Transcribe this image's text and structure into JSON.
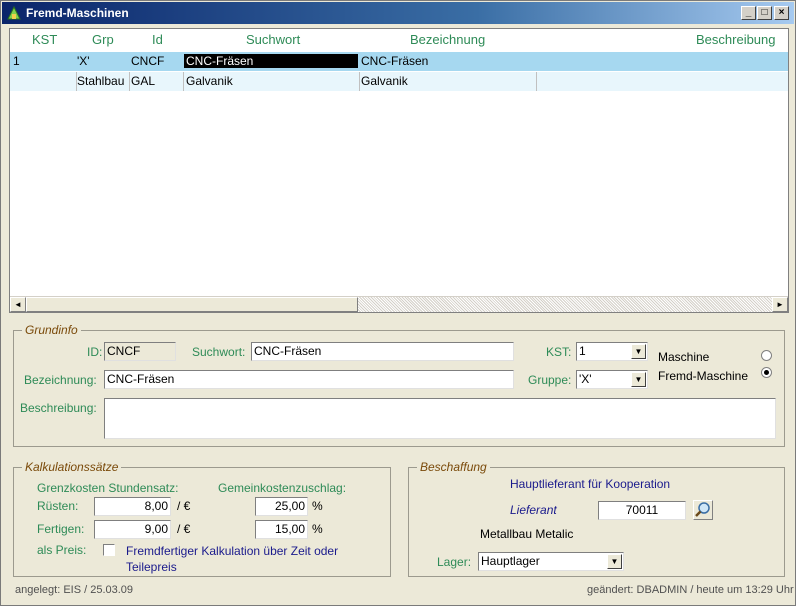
{
  "window": {
    "title": "Fremd-Maschinen",
    "minimize": "_",
    "maximize": "□",
    "close": "×"
  },
  "grid": {
    "columns": [
      "KST",
      "Grp",
      "Id",
      "Suchwort",
      "Bezeichnung",
      "Beschreibung"
    ],
    "rows": [
      {
        "kst": "1",
        "grp": "'X'",
        "id": "CNCF",
        "suchwort": "CNC-Fräsen",
        "bezeichnung": "CNC-Fräsen",
        "beschreibung": ""
      },
      {
        "kst": "",
        "grp": "Stahlbau",
        "id": "GAL",
        "suchwort": "Galvanik",
        "bezeichnung": "Galvanik",
        "beschreibung": ""
      }
    ],
    "scroll_left": "◄",
    "scroll_right": "►"
  },
  "grundinfo": {
    "legend": "Grundinfo",
    "id_label": "ID:",
    "id_value": "CNCF",
    "suchwort_label": "Suchwort:",
    "suchwort_value": "CNC-Fräsen",
    "kst_label": "KST:",
    "kst_value": "1",
    "bezeichnung_label": "Bezeichnung:",
    "bezeichnung_value": "CNC-Fräsen",
    "gruppe_label": "Gruppe:",
    "gruppe_value": "'X'",
    "beschreibung_label": "Beschreibung:",
    "beschreibung_value": "",
    "maschine_label": "Maschine",
    "fremd_maschine_label": "Fremd-Maschine",
    "selected_type": "Fremd-Maschine",
    "dropdown_arrow": "▼"
  },
  "kalkulation": {
    "legend": "Kalkulationssätze",
    "grenzkosten_label": "Grenzkosten Stundensatz:",
    "gemeinkosten_label": "Gemeinkostenzuschlag:",
    "ruesten_label": "Rüsten:",
    "ruesten_value": "8,00",
    "ruesten_unit": "/ €",
    "ruesten_pct": "25,00",
    "fertigen_label": "Fertigen:",
    "fertigen_value": "9,00",
    "fertigen_unit": "/ €",
    "fertigen_pct": "15,00",
    "pct_sign": "%",
    "als_preis_label": "als Preis:",
    "als_preis_checked": false,
    "fremdfertiger_text": "Fremdfertiger Kalkulation über Zeit oder Teilepreis"
  },
  "beschaffung": {
    "legend": "Beschaffung",
    "hauptlieferant_label": "Hauptlieferant für Kooperation",
    "lieferant_label": "Lieferant",
    "lieferant_value": "70011",
    "lieferant_name": "Metallbau Metalic",
    "lager_label": "Lager:",
    "lager_value": "Hauptlager"
  },
  "footer": {
    "created": "angelegt: EIS / 25.03.09",
    "changed": "geändert: DBADMIN / heute um 13:29 Uhr"
  },
  "colors": {
    "label_green": "#2e8b57",
    "selected_row": "#a6d8f0",
    "alt_row": "#e8f6fc",
    "legend_brown": "#7a4a0a",
    "link_blue": "#1a1a8c"
  }
}
